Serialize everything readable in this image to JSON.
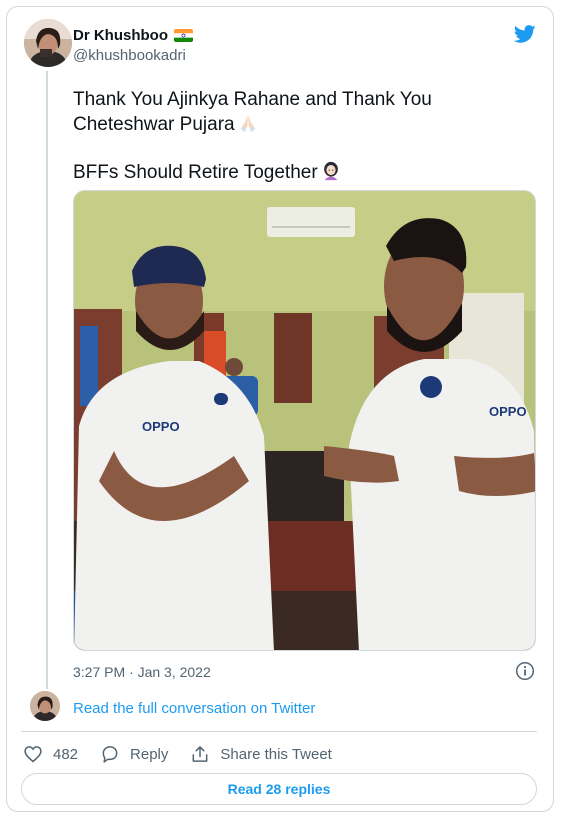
{
  "author": {
    "name": "Dr Khushboo",
    "handle": "@khushbookadri",
    "flag_icon": "india-flag-icon"
  },
  "tweet": {
    "line1": "Thank You Ajinkya Rahane and Thank You",
    "line2": "Cheteshwar Pujara",
    "line3": "BFFs Should Retire Together",
    "emoji1": "folded-hands-emoji",
    "emoji2": "woman-emoji"
  },
  "timestamp": "3:27 PM · Jan 3, 2022",
  "read_conversation": "Read the full conversation on Twitter",
  "actions": {
    "likes": "482",
    "reply_label": "Reply",
    "share_label": "Share this Tweet"
  },
  "read_replies": "Read 28 replies",
  "colors": {
    "accent": "#1d9bf0",
    "muted": "#536471",
    "border": "#cfd9de"
  }
}
